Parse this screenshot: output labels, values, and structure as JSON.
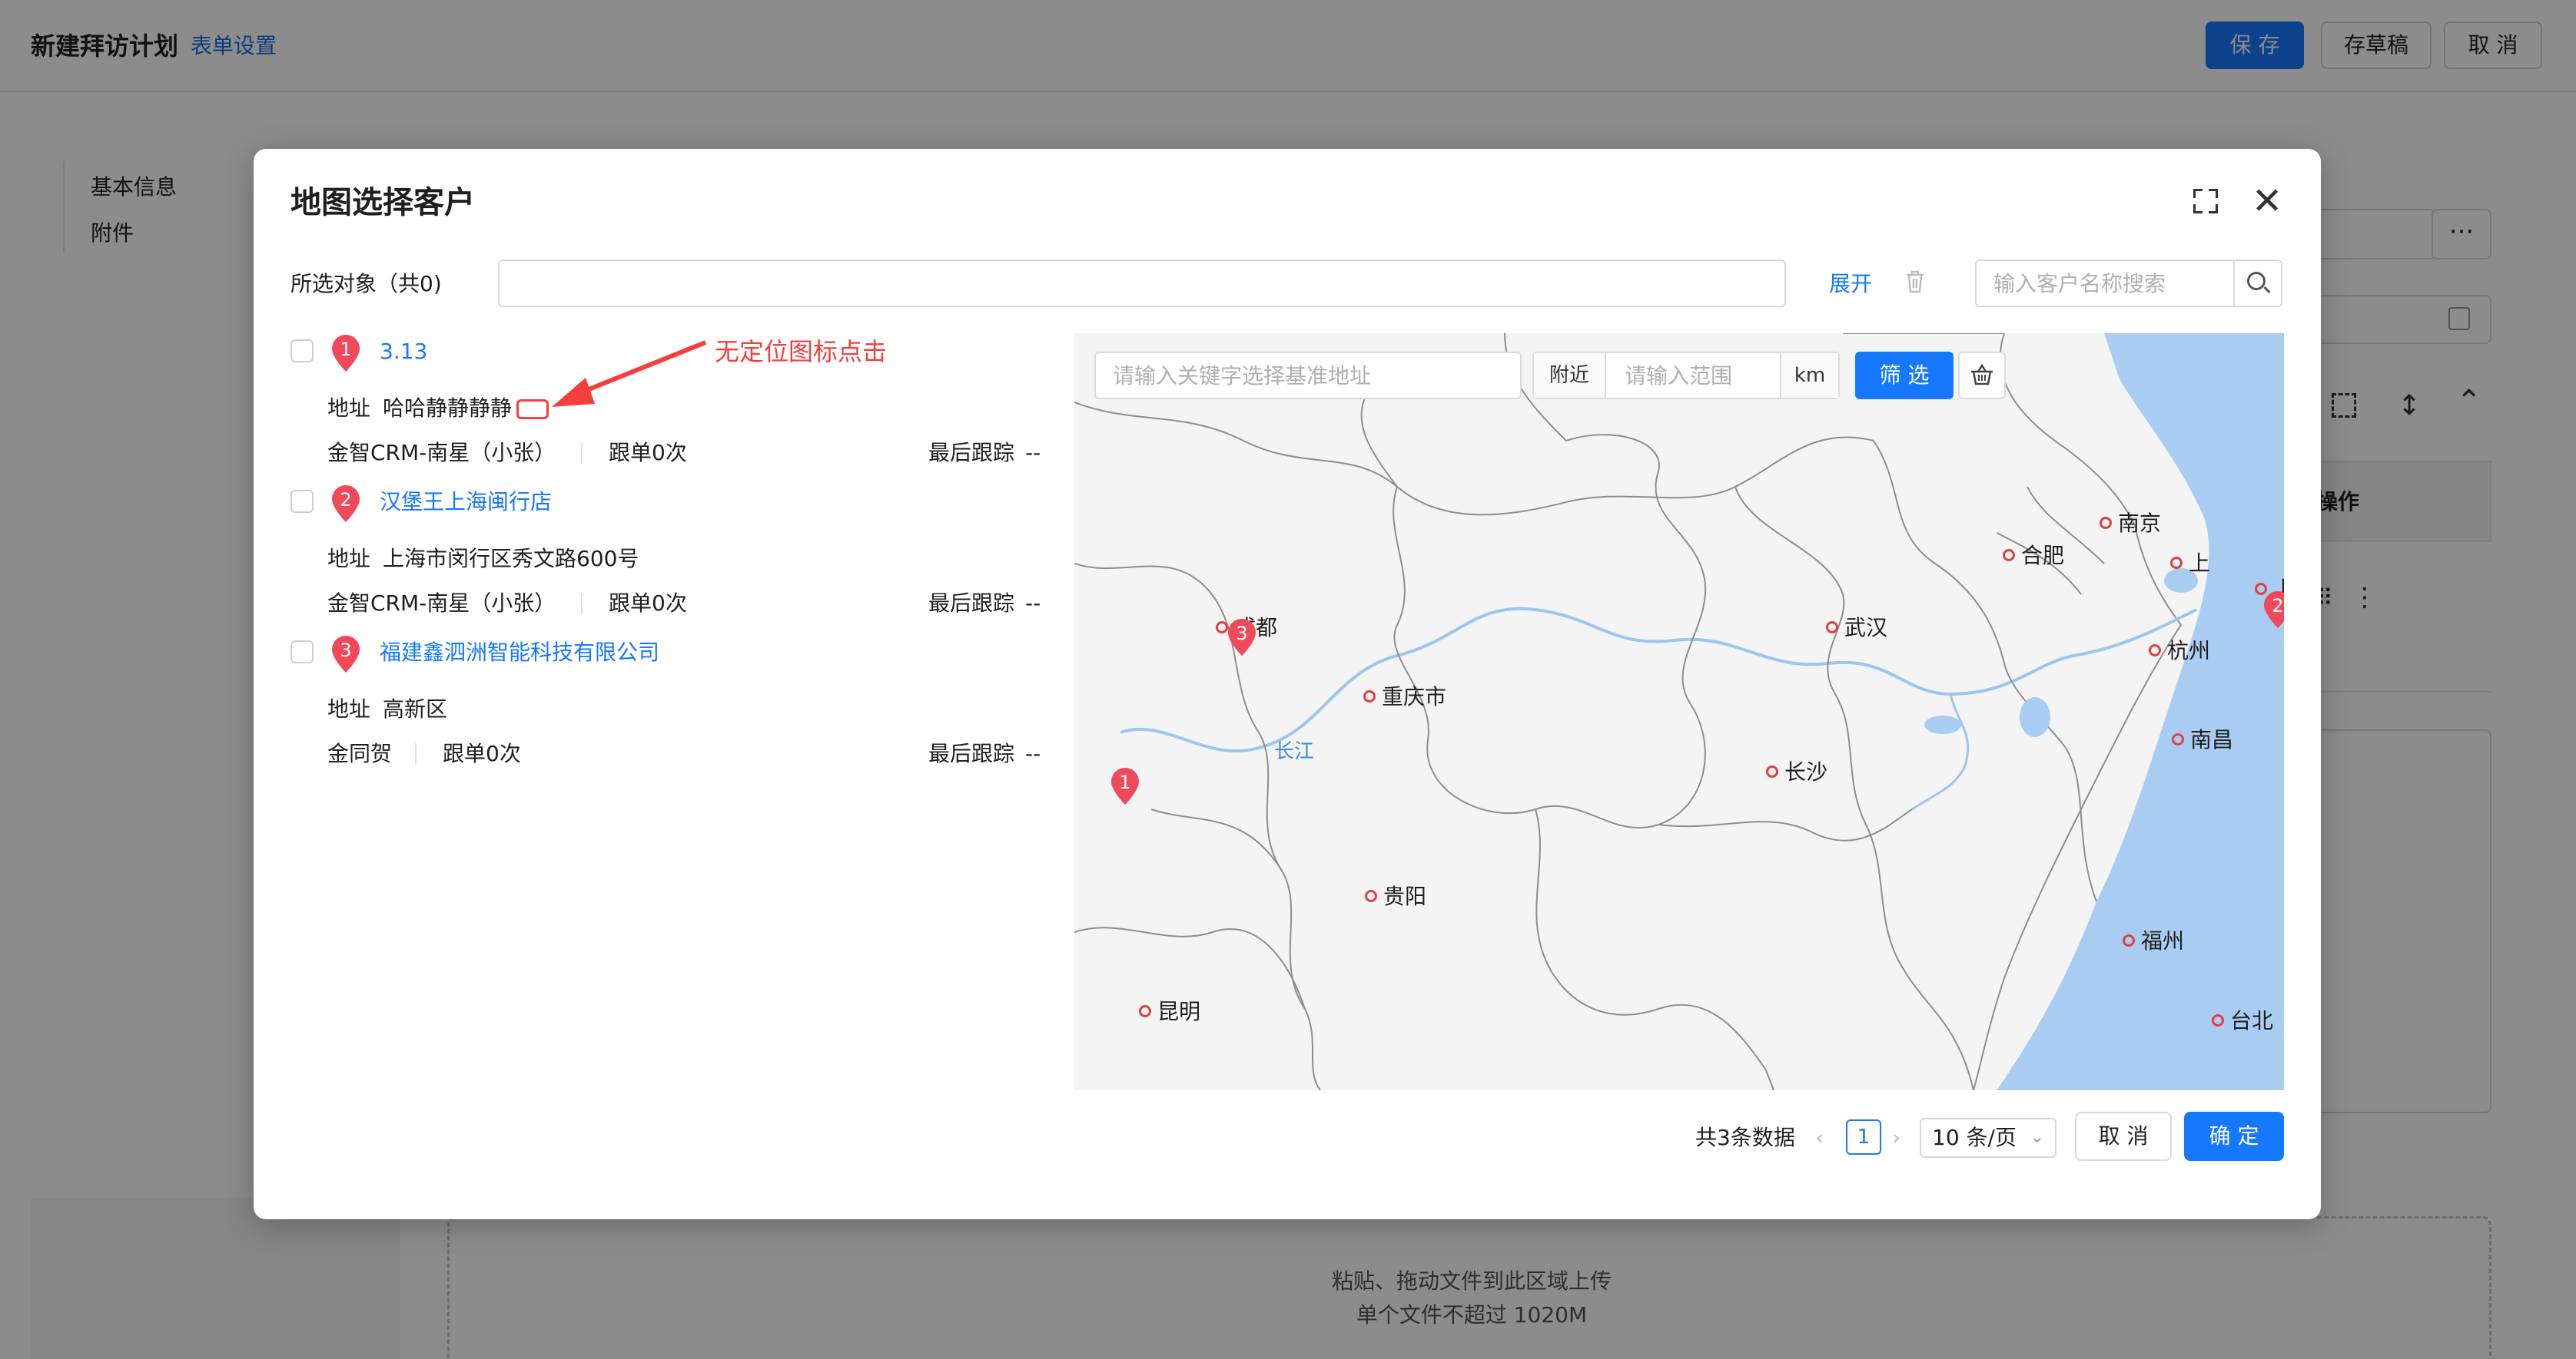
{
  "header": {
    "title": "新建拜访计划",
    "form_settings": "表单设置",
    "save": "保 存",
    "draft": "存草稿",
    "cancel": "取 消"
  },
  "sidebar": {
    "items": [
      "基本信息",
      "附件"
    ]
  },
  "background": {
    "operation_col": "操作"
  },
  "upload": {
    "hint": "粘贴、拖动文件到此区域上传",
    "limit": "单个文件不超过 1020M"
  },
  "modal": {
    "title": "地图选择客户",
    "selected_label": "所选对象（共0)",
    "expand": "展开",
    "search_placeholder": "输入客户名称搜索",
    "annotation": "无定位图标点击",
    "customers": [
      {
        "num": "1",
        "name": "3.13",
        "address_label": "地址",
        "address": "哈哈静静静静",
        "owner": "金智CRM-南星（小张）",
        "follow": "跟单0次",
        "last_label": "最后跟踪",
        "last_value": "--"
      },
      {
        "num": "2",
        "name": "汉堡王上海闽行店",
        "address_label": "地址",
        "address": "上海市闵行区秀文路600号",
        "owner": "金智CRM-南星（小张）",
        "follow": "跟单0次",
        "last_label": "最后跟踪",
        "last_value": "--"
      },
      {
        "num": "3",
        "name": "福建鑫泗洲智能科技有限公司",
        "address_label": "地址",
        "address": "高新区",
        "owner": "金同贺",
        "follow": "跟单0次",
        "last_label": "最后跟踪",
        "last_value": "--"
      }
    ],
    "map": {
      "keyword_placeholder": "请输入关键字选择基准地址",
      "nearby": "附近",
      "range_placeholder": "请输入范围",
      "unit": "km",
      "filter": "筛 选",
      "river_label": "长江",
      "cities": [
        "南京",
        "合肥",
        "上",
        "成都",
        "武汉",
        "杭州",
        "重庆市",
        "南昌",
        "长沙",
        "贵阳",
        "福州",
        "昆明",
        "台北"
      ],
      "markers": [
        "1",
        "2",
        "3"
      ]
    },
    "footer": {
      "total": "共3条数据",
      "page": "1",
      "page_size": "10 条/页",
      "cancel": "取 消",
      "ok": "确 定"
    }
  }
}
